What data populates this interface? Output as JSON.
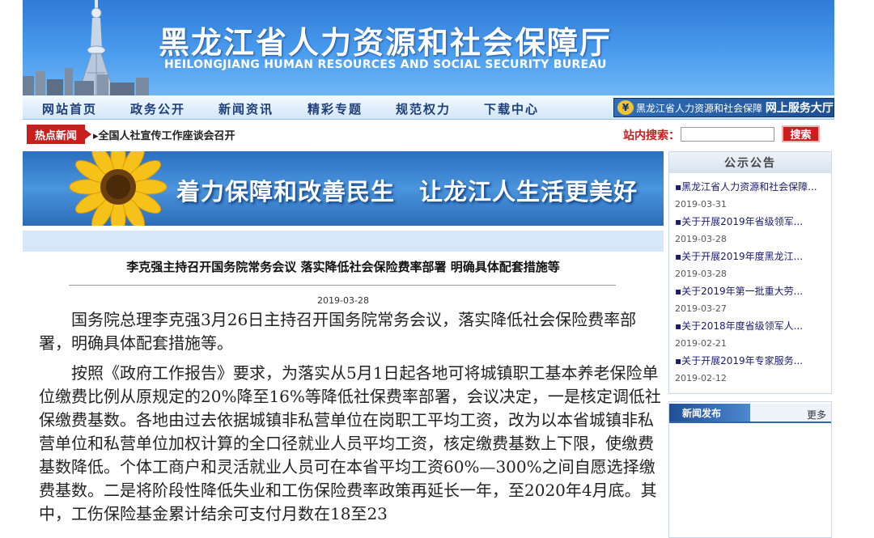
{
  "header": {
    "title_cn": "黑龙江省人力资源和社会保障厅",
    "title_en": "HEILONGJIANG HUMAN RESOURCES AND SOCIAL SECURITY BUREAU"
  },
  "nav": {
    "items": [
      "网站首页",
      "政务公开",
      "新闻资讯",
      "精彩专题",
      "规范权力",
      "下载中心"
    ],
    "service_hall": "黑龙江省人力资源和社会保障",
    "service_hall_bold": "网上服务大厅"
  },
  "hot_news": {
    "label": "热点新闻",
    "text": "▸全国人社宣传工作座谈会召开"
  },
  "search": {
    "label": "站内搜索：",
    "value": "",
    "button": "搜索"
  },
  "slogan": {
    "text": "着力保障和改善民生　让龙江人生活更美好"
  },
  "article": {
    "title": "李克强主持召开国务院常务会议 落实降低社会保险费率部署 明确具体配套措施等",
    "date": "2019-03-28",
    "paragraphs": [
      "国务院总理李克强3月26日主持召开国务院常务会议，落实降低社会保险费率部署，明确具体配套措施等。",
      "按照《政府工作报告》要求，为落实从5月1日起各地可将城镇职工基本养老保险单位缴费比例从原规定的20%降至16%等降低社保费率部署，会议决定，一是核定调低社保缴费基数。各地由过去依据城镇非私营单位在岗职工平均工资，改为以本省城镇非私营单位和私营单位加权计算的全口径就业人员平均工资，核定缴费基数上下限，使缴费基数降低。个体工商户和灵活就业人员可在本省平均工资60%—300%之间自愿选择缴费基数。二是将阶段性降低失业和工伤保险费率政策再延长一年，至2020年4月底。其中，工伤保险基金累计结余可支付月数在18至23"
    ]
  },
  "notices": {
    "title": "公示公告",
    "items": [
      {
        "text": "▪黑龙江省人力资源和社会保障...",
        "date": "2019-03-31"
      },
      {
        "text": "▪关于开展2019年省级领军...",
        "date": "2019-03-28"
      },
      {
        "text": "▪关于开展2019年度黑龙江...",
        "date": "2019-03-28"
      },
      {
        "text": "▪关于2019年第一批重大劳...",
        "date": "2019-03-27"
      },
      {
        "text": "▪关于2018年度省级领军人...",
        "date": "2019-02-21"
      },
      {
        "text": "▪关于开展2019年专家服务...",
        "date": "2019-02-12"
      }
    ]
  },
  "news_release": {
    "title": "新闻发布",
    "more": "更多"
  },
  "colors": {
    "header_blue": "#3a88e0",
    "nav_text": "#1e3f78",
    "hot_red": "#c81e1e",
    "article_bar": "#d5e7f8"
  }
}
